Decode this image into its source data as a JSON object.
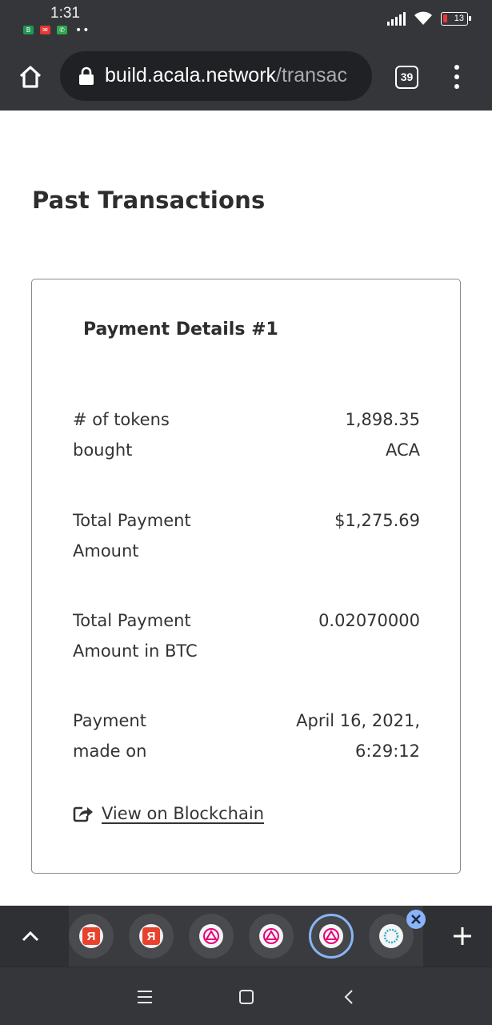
{
  "status_bar": {
    "time": "1:31",
    "battery_level": "13",
    "notification_icons": [
      "whatsapp-business-icon",
      "mail-icon",
      "phone-icon"
    ]
  },
  "browser": {
    "url_domain": "build.acala.network",
    "url_path": "/transac",
    "tab_count": "39"
  },
  "page": {
    "title": "Past Transactions",
    "card": {
      "title": "Payment Details #1",
      "rows": [
        {
          "label": "# of tokens\nbought",
          "value": "1,898.35\nACA"
        },
        {
          "label": "Total Payment\nAmount",
          "value": "$1,275.69"
        },
        {
          "label": "Total Payment\nAmount in BTC",
          "value": "0.02070000"
        },
        {
          "label": "Payment\nmade on",
          "value": "April 16, 2021,\n6:29:12"
        }
      ],
      "link_label": "View on Blockchain"
    }
  },
  "tab_strip": {
    "tabs": [
      {
        "icon": "yandex-icon",
        "letter": "Я"
      },
      {
        "icon": "yandex-icon",
        "letter": "Я"
      },
      {
        "icon": "acala-icon"
      },
      {
        "icon": "acala-icon"
      },
      {
        "icon": "acala-icon",
        "active": true
      },
      {
        "icon": "polkadot-ring-icon"
      }
    ]
  },
  "colors": {
    "chrome_bg": "#35363a",
    "url_bar_bg": "#202124",
    "active_tab_ring": "#8ab4f8",
    "yandex_red": "#e8412c",
    "acala_pink": "#e6007a"
  }
}
